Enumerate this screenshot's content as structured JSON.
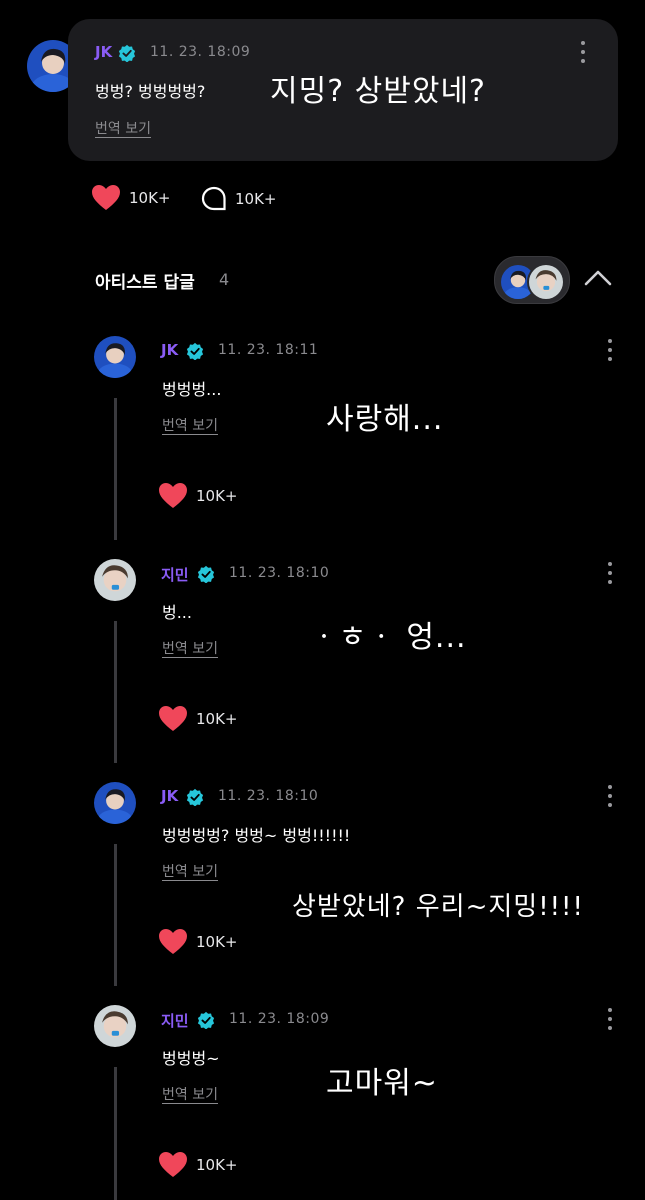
{
  "post": {
    "author": "JK",
    "time": "11. 23. 18:09",
    "message": "벙벙? 벙벙벙벙?",
    "translate": "번역 보기",
    "overlay": "지밍? 상받았네?",
    "likes": "10K+",
    "comments": "10K+"
  },
  "replies_section": {
    "title": "아티스트 답글",
    "count": "4"
  },
  "replies": [
    {
      "author": "JK",
      "time": "11. 23. 18:11",
      "message": "벙벙벙...",
      "translate": "번역 보기",
      "likes": "10K+",
      "overlay": "사랑해..."
    },
    {
      "author": "지민",
      "time": "11. 23. 18:10",
      "message": "벙...",
      "translate": "번역 보기",
      "likes": "10K+",
      "overlay": "ㆍㅎㆍ 엉..."
    },
    {
      "author": "JK",
      "time": "11. 23. 18:10",
      "message": "벙벙벙벙? 벙벙~ 벙벙!!!!!!",
      "translate": "번역 보기",
      "likes": "10K+",
      "overlay": "상받았네? 우리~지밍!!!!"
    },
    {
      "author": "지민",
      "time": "11. 23. 18:09",
      "message": "벙벙벙~",
      "translate": "번역 보기",
      "likes": "10K+",
      "overlay": "고마워~"
    }
  ],
  "colors": {
    "background": "#000000",
    "card": "#1c1c1f",
    "author_name": "#8a5cf5",
    "verified_badge": "#26c6da",
    "heart": "#f0475a",
    "muted_text": "#8a8a8e"
  },
  "icons": [
    "verified-badge-icon",
    "kebab-menu-icon",
    "heart-icon",
    "comment-bubble-icon",
    "chevron-up-icon"
  ]
}
